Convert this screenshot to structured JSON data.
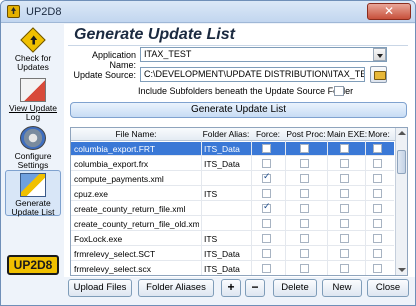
{
  "window": {
    "title": "UP2D8",
    "close_label": "✕"
  },
  "sidebar": {
    "items": [
      {
        "label_line1": "Check for",
        "label_line2": "Updates"
      },
      {
        "label_line1": "View Update",
        "label_line2": "Log"
      },
      {
        "label_line1": "Configure",
        "label_line2": "Settings"
      },
      {
        "label_line1": "Generate",
        "label_line2": "Update List"
      }
    ],
    "logo_text": "UP2D8"
  },
  "main": {
    "heading": "Generate Update List",
    "app_name_label": "Application Name:",
    "app_name_value": "ITAX_TEST",
    "source_label": "Update Source:",
    "source_value": "C:\\DEVELOPMENT\\UPDATE DISTRIBUTION\\ITAX_TEST",
    "include_subfolders_label": "Include Subfolders beneath the Update Source Folder",
    "include_subfolders_checked": false,
    "generate_button": "Generate Update List"
  },
  "table": {
    "columns": [
      "File Name:",
      "Folder Alias:",
      "Force:",
      "Post Proc:",
      "Main EXE:",
      "More:"
    ],
    "rows": [
      {
        "file": "columbia_export.FRT",
        "alias": "ITS_Data",
        "force": false,
        "post": false,
        "main": false,
        "selected": true
      },
      {
        "file": "columbia_export.frx",
        "alias": "ITS_Data",
        "force": false,
        "post": false,
        "main": false,
        "selected": false
      },
      {
        "file": "compute_payments.xml",
        "alias": "",
        "force": true,
        "post": false,
        "main": false,
        "selected": false
      },
      {
        "file": "cpuz.exe",
        "alias": "ITS",
        "force": false,
        "post": false,
        "main": false,
        "selected": false
      },
      {
        "file": "create_county_return_file.xml",
        "alias": "",
        "force": true,
        "post": false,
        "main": false,
        "selected": false
      },
      {
        "file": "create_county_return_file_old.xml",
        "alias": "",
        "force": false,
        "post": false,
        "main": false,
        "selected": false
      },
      {
        "file": "FoxLock.exe",
        "alias": "ITS",
        "force": false,
        "post": false,
        "main": false,
        "selected": false
      },
      {
        "file": "frmrelevy_select.SCT",
        "alias": "ITS_Data",
        "force": false,
        "post": false,
        "main": false,
        "selected": false
      },
      {
        "file": "frmrelevy_select.scx",
        "alias": "ITS_Data",
        "force": false,
        "post": false,
        "main": false,
        "selected": false
      }
    ]
  },
  "buttons": {
    "upload_files": "Upload Files",
    "folder_aliases": "Folder Aliases",
    "add": "+",
    "remove": "−",
    "delete": "Delete",
    "new": "New",
    "close": "Close"
  },
  "colors": {
    "selection": "#3a78d6",
    "logo": "#f0c000"
  }
}
